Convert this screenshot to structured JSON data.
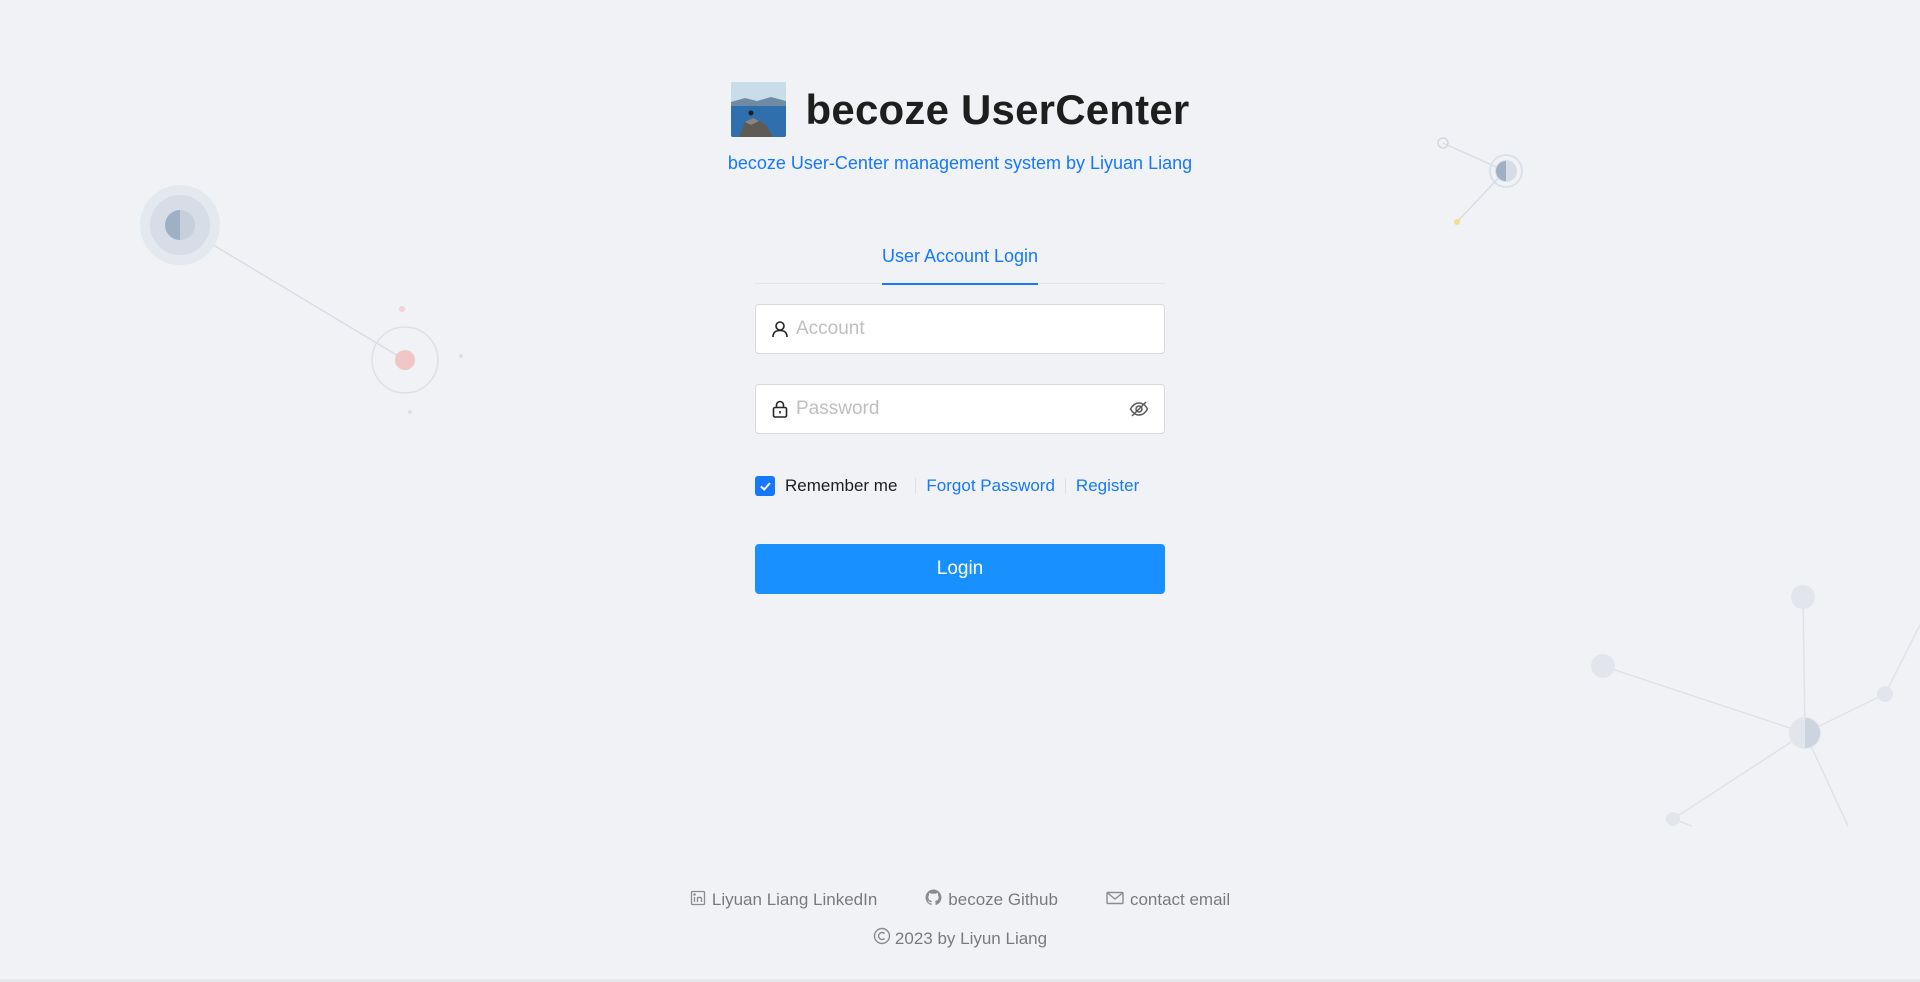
{
  "header": {
    "title": "becoze UserCenter",
    "subtitle": "becoze User-Center management system by Liyuan Liang"
  },
  "tabs": [
    {
      "label": "User Account Login",
      "active": true
    }
  ],
  "form": {
    "account_placeholder": "Account",
    "password_placeholder": "Password",
    "remember_label": "Remember me",
    "remember_checked": true,
    "forgot_label": "Forgot Password",
    "register_label": "Register",
    "login_label": "Login"
  },
  "footer": {
    "links": [
      {
        "label": "Liyuan Liang LinkedIn",
        "icon": "linkedin-icon"
      },
      {
        "label": "becoze Github",
        "icon": "github-icon"
      },
      {
        "label": "contact email",
        "icon": "mail-icon"
      }
    ],
    "copyright": "2023 by Liyun Liang"
  },
  "colors": {
    "primary": "#1677ff",
    "button": "#1890ff",
    "background": "#f0f2f5"
  }
}
